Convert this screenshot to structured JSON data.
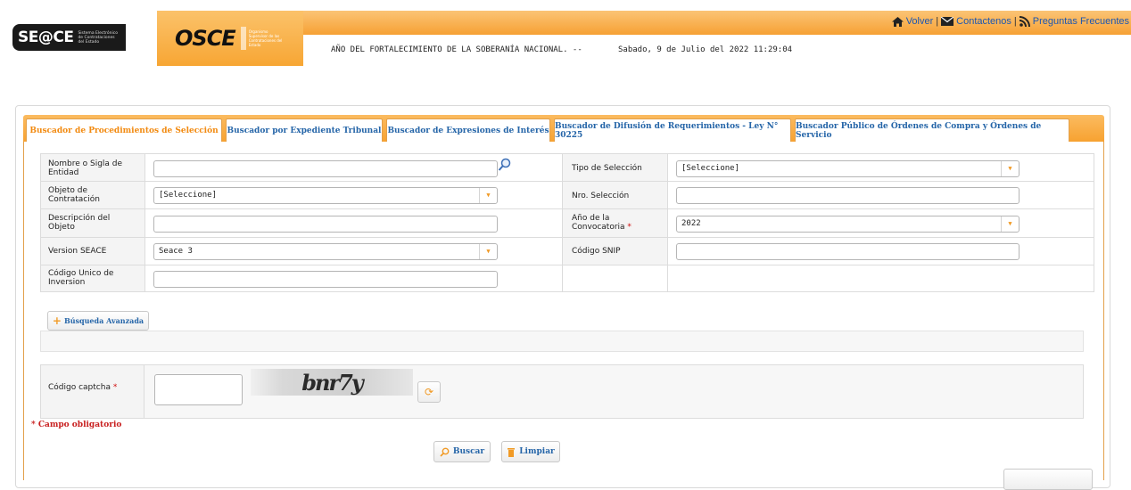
{
  "header": {
    "seace_logo": "SE@CE",
    "seace_subtitle": "Sistema Electrónico de Contrataciones del Estado",
    "osce_logo": "OSCE",
    "osce_subtitle": "Organismo Supervisor de las Contrataciones del Estado",
    "links": {
      "volver": "Volver",
      "contactenos": "Contactenos",
      "preguntas": "Preguntas Frecuentes"
    },
    "motto": "AÑO DEL FORTALECIMIENTO DE LA SOBERANÍA NACIONAL. --",
    "datetime": "Sabado, 9 de Julio del 2022 11:29:04"
  },
  "tabs": [
    {
      "label": "Buscador de Procedimientos de Selección",
      "active": true
    },
    {
      "label": "Buscador por Expediente Tribunal",
      "active": false
    },
    {
      "label": "Buscador de Expresiones de Interés",
      "active": false
    },
    {
      "label": "Buscador de Difusión de Requerimientos - Ley N° 30225",
      "active": false
    },
    {
      "label": "Buscador Público de Órdenes de Compra y Órdenes de Servicio",
      "active": false
    }
  ],
  "form": {
    "nombre_entidad": {
      "label": "Nombre o Sigla de Entidad",
      "value": ""
    },
    "tipo_seleccion": {
      "label": "Tipo de Selección",
      "value": "[Seleccione]"
    },
    "objeto_contratacion": {
      "label": "Objeto de Contratación",
      "value": "[Seleccione]"
    },
    "nro_seleccion": {
      "label": "Nro. Selección",
      "value": ""
    },
    "descripcion_objeto": {
      "label": "Descripción del Objeto",
      "value": ""
    },
    "anio_convocatoria": {
      "label": "Año de la Convocatoria",
      "required_mark": "*",
      "value": "2022"
    },
    "version_seace": {
      "label": "Version SEACE",
      "value": "Seace 3"
    },
    "codigo_snip": {
      "label": "Código SNIP",
      "value": ""
    },
    "codigo_inversion": {
      "label": "Código Unico de Inversion",
      "value": ""
    }
  },
  "advanced": {
    "label": "Búsqueda Avanzada"
  },
  "captcha": {
    "label": "Código captcha",
    "required_mark": "*",
    "image_text": "bnr7y",
    "value": ""
  },
  "required_note": "* Campo obligatorio",
  "actions": {
    "buscar": "Buscar",
    "limpiar": "Limpiar"
  },
  "colors": {
    "orange": "#f7a231",
    "link_blue": "#2565a8",
    "active_tab": "#f28a10",
    "required_red": "#d01010"
  }
}
